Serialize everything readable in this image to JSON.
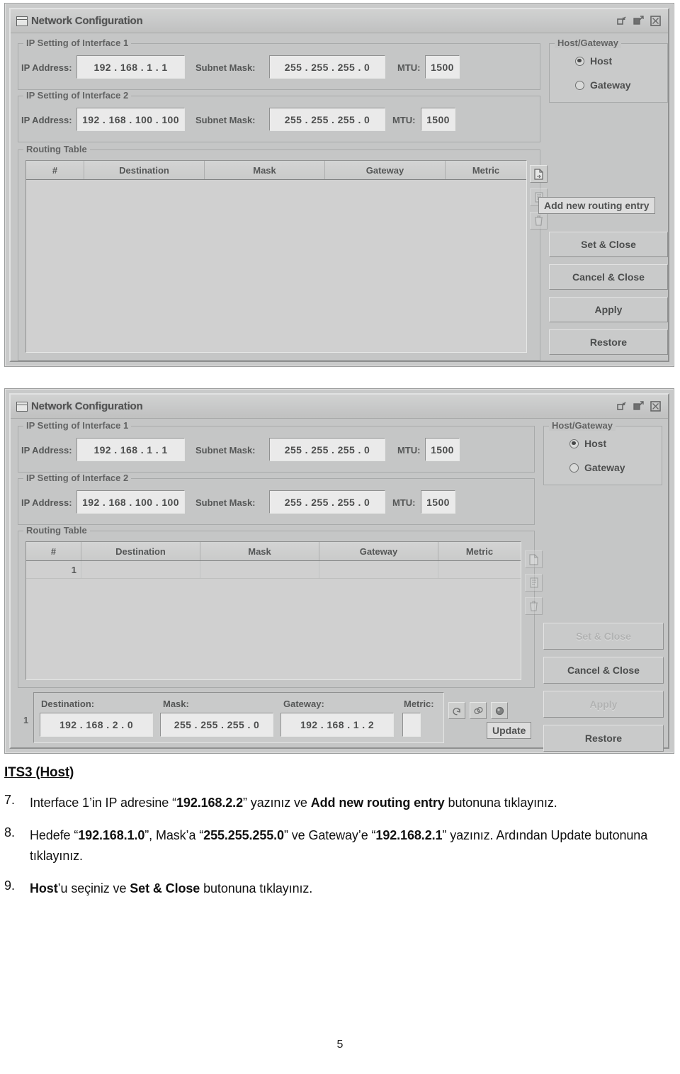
{
  "dialog": {
    "title": "Network Configuration",
    "window_controls": [
      "minimize-icon",
      "maximize-icon",
      "close-icon"
    ],
    "groups": {
      "iface1_legend": "IP Setting of Interface 1",
      "iface2_legend": "IP Setting of Interface 2",
      "routing_legend": "Routing Table",
      "hostgw_legend": "Host/Gateway"
    },
    "labels": {
      "ip_address": "IP Address:",
      "subnet_mask": "Subnet Mask:",
      "mtu": "MTU:"
    },
    "iface1": {
      "ip": "192 . 168 .  1  .  1",
      "mask": "255 . 255 . 255 .  0",
      "mtu": "1500"
    },
    "iface2": {
      "ip": "192 . 168 . 100 . 100",
      "mask": "255 . 255 . 255 .  0",
      "mtu": "1500"
    },
    "table_headers": [
      "#",
      "Destination",
      "Mask",
      "Gateway",
      "Metric"
    ],
    "radios": [
      {
        "label": "Host",
        "selected": true
      },
      {
        "label": "Gateway",
        "selected": false
      }
    ],
    "buttons": {
      "set_close": "Set & Close",
      "cancel_close": "Cancel & Close",
      "apply": "Apply",
      "restore": "Restore"
    },
    "tooltip_add": "Add new routing entry",
    "tooltip_update": "Update"
  },
  "screenshot1": {
    "routing_rows": []
  },
  "screenshot2": {
    "routing_rows": [
      {
        "num": "1",
        "destination": "",
        "mask": "",
        "gateway": "",
        "metric": ""
      }
    ],
    "edit_row": {
      "index": "1",
      "destination_label": "Destination:",
      "mask_label": "Mask:",
      "gateway_label": "Gateway:",
      "metric_label": "Metric:",
      "destination": "192 . 168 .  2  .  0",
      "mask": "255 . 255 . 255 .  0",
      "gateway": "192 . 168 .  1  .  2",
      "metric": ""
    },
    "disabled_buttons": [
      "Set & Close",
      "Apply"
    ]
  },
  "document": {
    "heading": "ITS3 (Host)",
    "items": [
      {
        "num": "7.",
        "parts": [
          {
            "t": "Interface 1’in IP adresine “",
            "b": false
          },
          {
            "t": "192.168.2.2",
            "b": true
          },
          {
            "t": "” yazınız ve ",
            "b": false
          },
          {
            "t": "Add new routing entry",
            "b": true
          },
          {
            "t": " butonuna tıklayınız.",
            "b": false
          }
        ]
      },
      {
        "num": "8.",
        "parts": [
          {
            "t": "Hedefe “",
            "b": false
          },
          {
            "t": "192.168.1.0",
            "b": true
          },
          {
            "t": "”, Mask’a “",
            "b": false
          },
          {
            "t": "255.255.255.0",
            "b": true
          },
          {
            "t": "” ve Gateway’e “",
            "b": false
          },
          {
            "t": "192.168.2.1",
            "b": true
          },
          {
            "t": "” yazınız. Ardından Update butonuna tıklayınız.",
            "b": false
          }
        ]
      },
      {
        "num": "9.",
        "parts": [
          {
            "t": "Host",
            "b": true
          },
          {
            "t": "’u seçiniz ve ",
            "b": false
          },
          {
            "t": "Set & Close",
            "b": true
          },
          {
            "t": " butonuna tıklayınız.",
            "b": false
          }
        ]
      }
    ],
    "page_number": "5"
  }
}
